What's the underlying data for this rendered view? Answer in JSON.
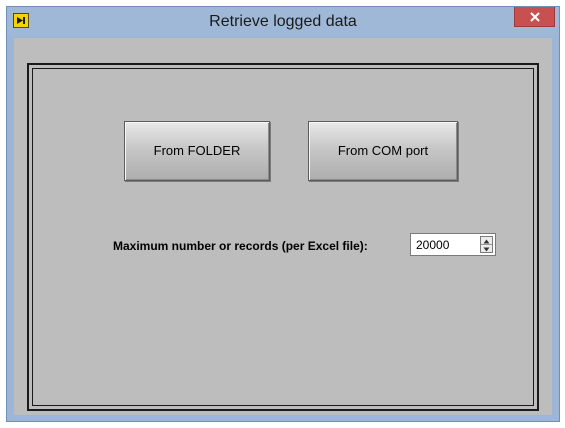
{
  "window": {
    "title": "Retrieve logged data",
    "app_icon": "labview-icon",
    "close_icon": "close-icon"
  },
  "buttons": {
    "from_folder": "From FOLDER",
    "from_com_port": "From COM port"
  },
  "max_records": {
    "label": "Maximum number or records (per Excel file):",
    "value": "20000"
  },
  "colors": {
    "client_background": "#bdbdbd",
    "title_bar": "#9fb8d8",
    "close_button": "#c75050"
  }
}
